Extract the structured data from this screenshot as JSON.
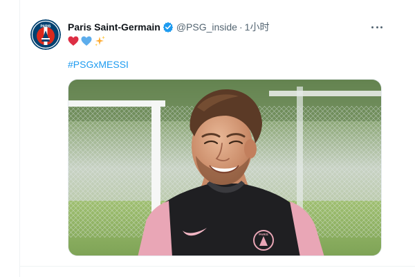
{
  "tweet": {
    "author": {
      "display_name": "Paris Saint-Germain",
      "handle": "@PSG_inside",
      "verified": true,
      "avatar_icon": "psg-crest-icon",
      "avatar_text": "PARIS"
    },
    "separator": "·",
    "timestamp": "1小时",
    "emojis": [
      "red-heart-icon",
      "blue-heart-icon",
      "sparkles-icon"
    ],
    "hashtag": "#PSGxMESSI",
    "media": {
      "description": "player-smiling-at-training-photo",
      "shirt_crest_text": "PARIS"
    },
    "more_icon": "more-dots-icon"
  },
  "colors": {
    "link": "#1d9bf0",
    "verified": "#1d9bf0",
    "muted": "#536471",
    "psg_navy": "#004170",
    "psg_red": "#da291c"
  }
}
